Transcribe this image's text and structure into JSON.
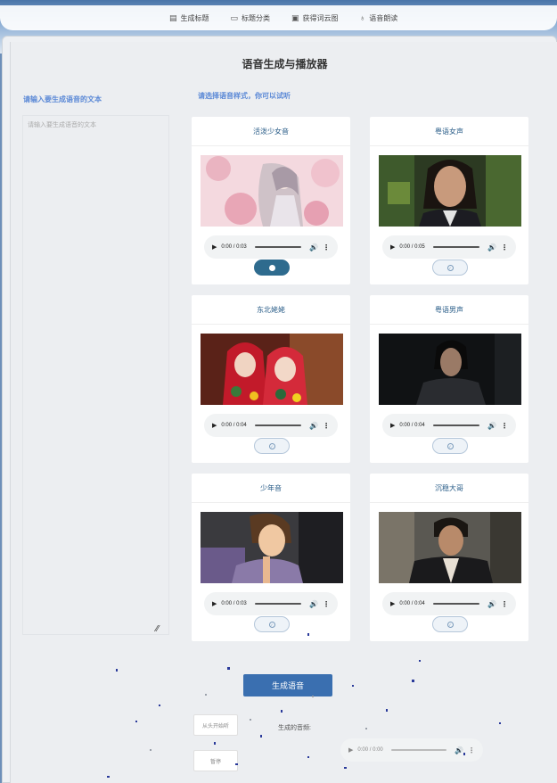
{
  "nav": {
    "items": [
      {
        "label": "生成标题",
        "icon": "document-icon"
      },
      {
        "label": "标题分类",
        "icon": "folder-icon"
      },
      {
        "label": "获得词云图",
        "icon": "image-icon"
      },
      {
        "label": "语音朗读",
        "icon": "microphone-icon"
      }
    ]
  },
  "page": {
    "title": "语音生成与播放器",
    "left_label": "请输入要生成语音的文本",
    "textarea_placeholder": "请输入要生成语音的文本",
    "right_label": "请选择语音样式，你可以试听"
  },
  "voices": [
    {
      "name": "活泼少女音",
      "time": "0:00 / 0:03",
      "selected": true,
      "image": "anime-girl-cherry-blossom"
    },
    {
      "name": "粤语女声",
      "time": "0:00 / 0:05",
      "selected": false,
      "image": "woman-portrait"
    },
    {
      "name": "东北姥姥",
      "time": "0:00 / 0:04",
      "selected": false,
      "image": "two-girls-red-headscarf"
    },
    {
      "name": "粤语男声",
      "time": "0:00 / 0:04",
      "selected": false,
      "image": "man-dark-room"
    },
    {
      "name": "少年音",
      "time": "0:00 / 0:03",
      "selected": false,
      "image": "anime-boy"
    },
    {
      "name": "沉稳大哥",
      "time": "0:00 / 0:04",
      "selected": false,
      "image": "man-leather-jacket"
    }
  ],
  "actions": {
    "generate_label": "生成语音",
    "restart_label": "从头开始听",
    "pause_label": "暂停",
    "generated_audio_label": "生成的音频:",
    "generated_time": "0:00 / 0:00"
  },
  "colors": {
    "accent_blue": "#3a6fb0",
    "label_blue": "#5a88d6",
    "selected_teal": "#2e6b8e"
  }
}
